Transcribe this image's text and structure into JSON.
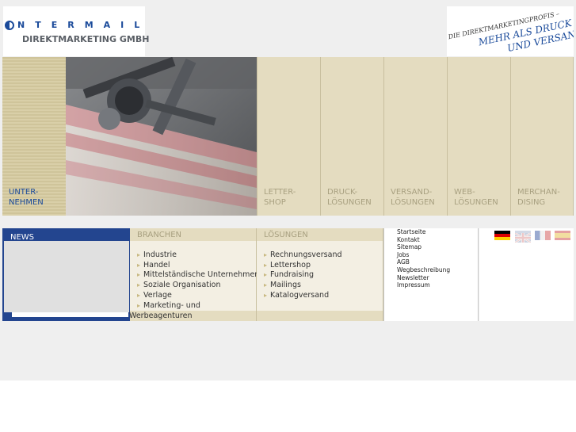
{
  "logo": {
    "top_text": "NTERMAIL",
    "bottom_text": "DIREKTMARKETING GMBH"
  },
  "slogan": {
    "line1": "DIE DIREKTMARKETINGPROFIS –",
    "line2": "MEHR ALS DRUCK",
    "line3": "UND VERSAND!"
  },
  "nav": {
    "items": [
      {
        "label": "UNTER-\nNEHMEN",
        "active": true
      },
      {
        "label": "LETTER-\nSHOP"
      },
      {
        "label": "DRUCK-\nLÖSUNGEN"
      },
      {
        "label": "VERSAND-\nLÖSUNGEN"
      },
      {
        "label": "WEB-\nLÖSUNGEN"
      },
      {
        "label": "MERCHAN-\nDISING"
      }
    ]
  },
  "news": {
    "title": "NEWS"
  },
  "branchen": {
    "title": "BRANCHEN",
    "items": [
      "Industrie",
      "Handel",
      "Mittelständische Unternehmen",
      "Soziale Organisation",
      "Verlage",
      "Marketing- und"
    ],
    "overflow": "Werbeagenturen"
  },
  "loesungen": {
    "title": "LÖSUNGEN",
    "items": [
      "Rechnungsversand",
      "Lettershop",
      "Fundraising",
      "Mailings",
      "Katalogversand"
    ]
  },
  "footer_links": [
    "Startseite",
    "Kontakt",
    "Sitemap",
    "Jobs",
    "AGB",
    "Wegbeschreibung",
    "Newsletter",
    "Impressum"
  ],
  "flags": [
    "flag-de-icon",
    "flag-en-icon",
    "flag-fr-icon",
    "flag-es-icon"
  ],
  "colors": {
    "brand_blue": "#23458f",
    "beige": "#e4dcc0",
    "beige_text": "#a8a080"
  }
}
